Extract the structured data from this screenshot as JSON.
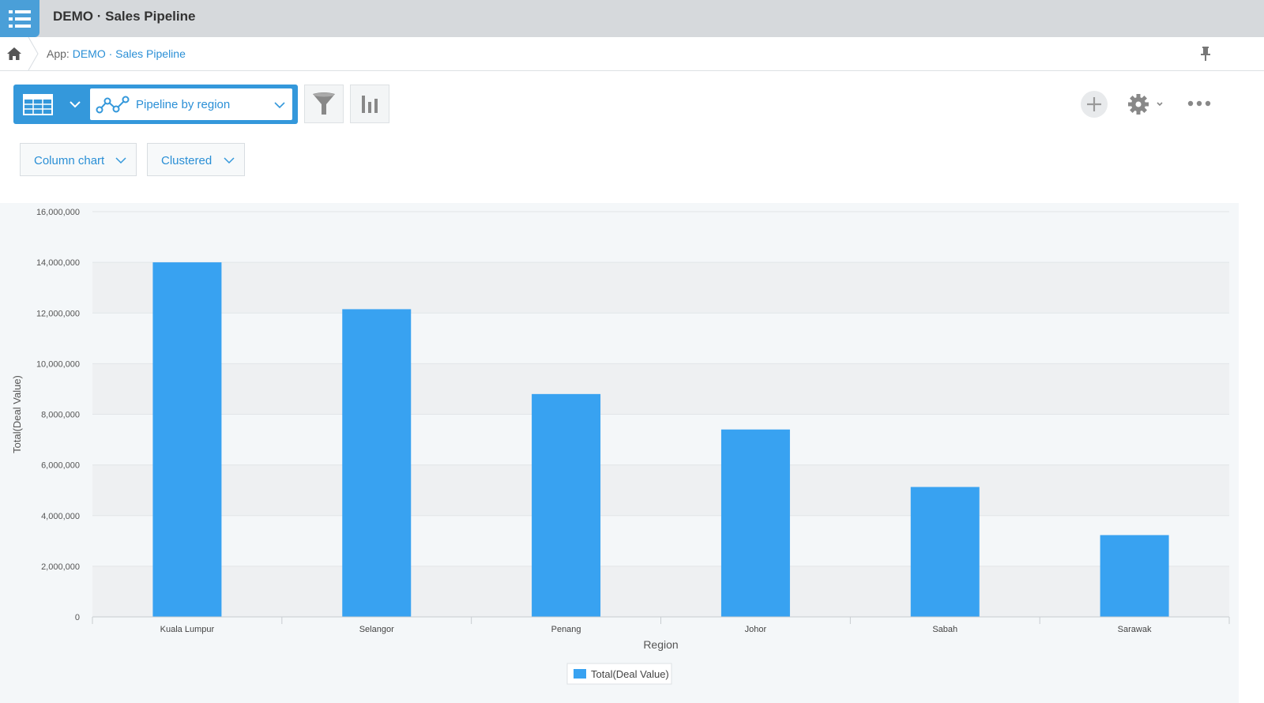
{
  "header": {
    "title": "DEMO · Sales Pipeline",
    "app_icon": "list-icon"
  },
  "breadcrumb": {
    "prefix": "App:",
    "link_text": "DEMO · Sales Pipeline",
    "home_icon": "home-icon",
    "pin_icon": "pin-icon"
  },
  "toolbar": {
    "view_name": "Pipeline by region",
    "view_icon": "graph-icon",
    "table_icon": "table-icon",
    "filter_icon": "filter-icon",
    "graph_settings_icon": "bar-chart-icon",
    "add_icon": "plus-icon",
    "settings_icon": "gear-icon",
    "more_icon": "more-icon"
  },
  "chart_options": {
    "chart_type": "Column chart",
    "mode": "Clustered"
  },
  "colors": {
    "accent": "#3498db",
    "bar": "#38a2f1",
    "link": "#2a8fd6"
  },
  "chart_data": {
    "type": "bar",
    "title": "",
    "xlabel": "Region",
    "ylabel": "Total(Deal Value)",
    "categories": [
      "Kuala Lumpur",
      "Selangor",
      "Penang",
      "Johor",
      "Sabah",
      "Sarawak"
    ],
    "series": [
      {
        "name": "Total(Deal Value)",
        "values": [
          14000000,
          12150000,
          8800000,
          7400000,
          5130000,
          3230000
        ]
      }
    ],
    "ylim": [
      0,
      16000000
    ],
    "yticks": [
      "0",
      "2,000,000",
      "4,000,000",
      "6,000,000",
      "8,000,000",
      "10,000,000",
      "12,000,000",
      "14,000,000",
      "16,000,000"
    ],
    "grid": true,
    "legend": "bottom-center"
  }
}
